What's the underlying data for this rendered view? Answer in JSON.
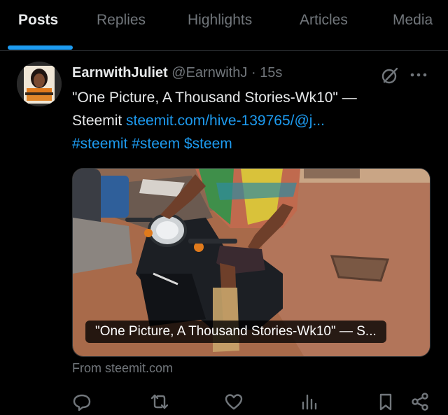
{
  "tabs": [
    {
      "label": "Posts",
      "active": true
    },
    {
      "label": "Replies",
      "active": false
    },
    {
      "label": "Highlights",
      "active": false
    },
    {
      "label": "Articles",
      "active": false
    },
    {
      "label": "Media",
      "active": false
    }
  ],
  "tweet": {
    "display_name": "EarnwithJuliet",
    "handle": "@EarnwithJ",
    "separator": "·",
    "time": "15s",
    "line1": "\"One Picture, A Thousand Stories-Wk10\" —",
    "line2_text": "Steemit ",
    "line2_link": "steemit.com/hive-139765/@j...",
    "line3": "#steemit #steem $steem",
    "media_caption": "\"One Picture, A Thousand Stories-Wk10\" — S...",
    "source": "From steemit.com"
  },
  "icons": {
    "grok": "grok-icon",
    "more": "more-icon",
    "reply": "reply-icon",
    "retweet": "retweet-icon",
    "like": "like-icon",
    "views": "views-icon",
    "bookmark": "bookmark-icon",
    "share": "share-icon"
  },
  "colors": {
    "accent": "#1d9bf0",
    "muted": "#71767b",
    "text": "#e7e9ea",
    "background": "#000000"
  }
}
